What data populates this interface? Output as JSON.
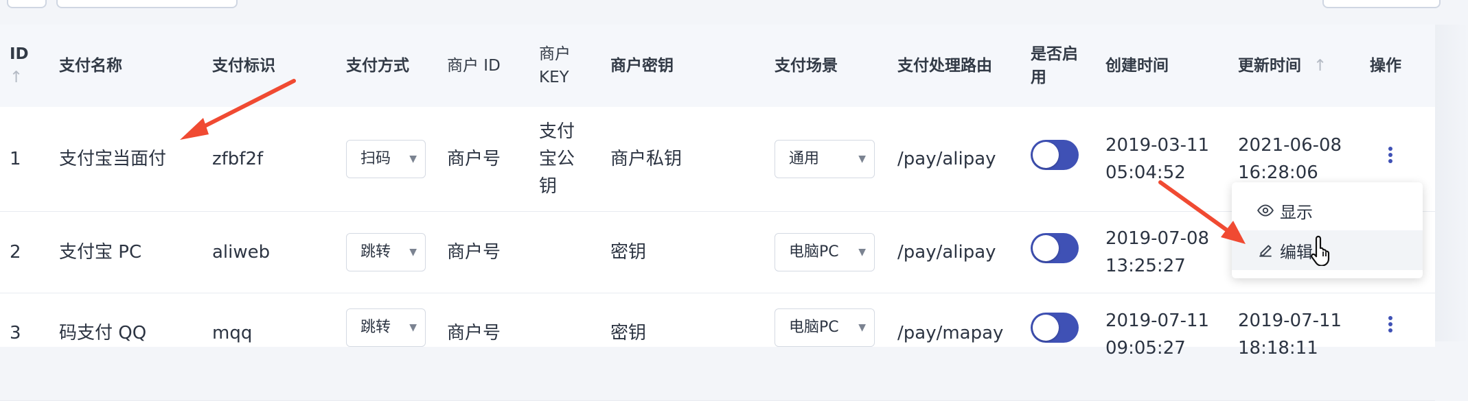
{
  "table": {
    "headers": {
      "id": "ID",
      "name": "支付名称",
      "code": "支付标识",
      "method": "支付方式",
      "merchant_id": "商户 ID",
      "merchant_key": "商户 KEY",
      "merchant_secret": "商户密钥",
      "scene": "支付场景",
      "route": "支付处理路由",
      "enabled": "是否启用",
      "created": "创建时间",
      "updated": "更新时间",
      "actions": "操作"
    },
    "sort_icon": "↑",
    "rows": [
      {
        "id": "1",
        "name": "支付宝当面付",
        "code": "zfbf2f",
        "method": "扫码",
        "merchant_id": "商户号",
        "merchant_key": "支付宝公钥",
        "merchant_secret": "商户私钥",
        "scene": "通用",
        "route": "/pay/alipay",
        "created_date": "2019-03-11",
        "created_time": "05:04:52",
        "updated_date": "2021-06-08",
        "updated_time": "16:28:06"
      },
      {
        "id": "2",
        "name": "支付宝 PC",
        "code": "aliweb",
        "method": "跳转",
        "merchant_id": "商户号",
        "merchant_key": "",
        "merchant_secret": "密钥",
        "scene": "电脑PC",
        "route": "/pay/alipay",
        "created_date": "2019-07-08",
        "created_time": "13:25:27",
        "updated_date": "",
        "updated_time": ""
      },
      {
        "id": "3",
        "name": "码支付 QQ",
        "code": "mqq",
        "method": "跳转",
        "merchant_id": "商户号",
        "merchant_key": "",
        "merchant_secret": "密钥",
        "scene": "电脑PC",
        "route": "/pay/mapay",
        "created_date": "2019-07-11",
        "created_time": "09:05:27",
        "updated_date": "2019-07-11",
        "updated_time": "18:18:11"
      }
    ]
  },
  "action_menu": {
    "items": [
      {
        "label": "显示",
        "icon": "eye-icon"
      },
      {
        "label": "编辑",
        "icon": "edit-icon"
      }
    ]
  },
  "colors": {
    "accent": "#3f51b5",
    "annotation_arrow": "#f04a32"
  }
}
